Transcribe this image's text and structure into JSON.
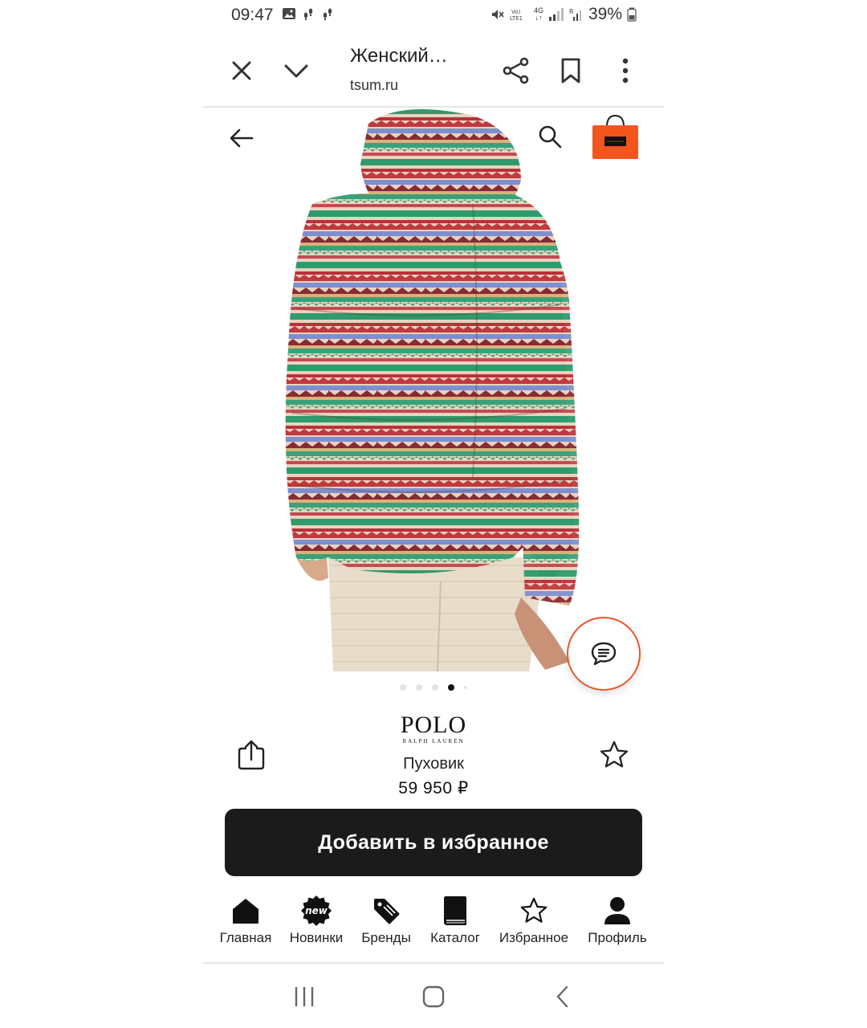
{
  "status_bar": {
    "time": "09:47",
    "battery": "39%",
    "network": "4G"
  },
  "browser": {
    "title": "Женский…",
    "url": "tsum.ru"
  },
  "product": {
    "brand": "POLO",
    "brand_sub": "RALPH LAUREN",
    "name": "Пуховик",
    "price": "59 950 ₽",
    "cta_label": "Добавить в избранное",
    "gallery": {
      "current_index": 4,
      "total": 5
    }
  },
  "bottom_nav": {
    "items": [
      {
        "label": "Главная",
        "icon": "home-icon"
      },
      {
        "label": "Новинки",
        "icon": "new-badge-icon"
      },
      {
        "label": "Бренды",
        "icon": "tag-icon"
      },
      {
        "label": "Каталог",
        "icon": "book-icon"
      },
      {
        "label": "Избранное",
        "icon": "star-icon"
      },
      {
        "label": "Профиль",
        "icon": "profile-icon"
      }
    ],
    "new_badge_text": "new"
  },
  "colors": {
    "accent": "#e8572a",
    "cta_bg": "#1b1b1b",
    "bag_orange": "#f2561d"
  }
}
